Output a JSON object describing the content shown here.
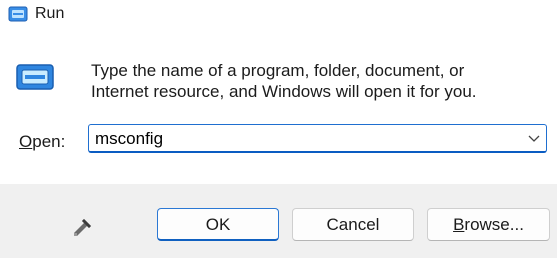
{
  "window": {
    "title": "Run",
    "title_icon": "run-app-icon"
  },
  "main": {
    "icon": "run-dialog-icon",
    "description_line1": "Type the name of a program, folder, document, or",
    "description_line2": "Internet resource, and Windows will open it for you.",
    "open_label_accel": "O",
    "open_label_rest": "pen:",
    "open_value": "msconfig"
  },
  "footer": {
    "icon": "admin-shield-icon",
    "ok_label": "OK",
    "cancel_label": "Cancel",
    "browse_label_accel": "B",
    "browse_label_rest": "rowse..."
  },
  "colors": {
    "accent": "#1f6fd0",
    "footer_bg": "#f0f0f0"
  }
}
